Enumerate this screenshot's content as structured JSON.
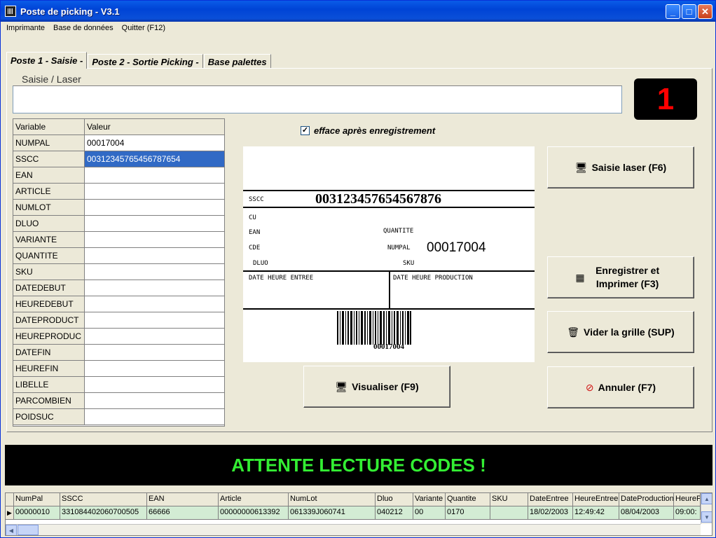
{
  "window": {
    "title": "Poste de picking - V3.1"
  },
  "menu": [
    {
      "label": "Imprimante"
    },
    {
      "label": "Base de données"
    },
    {
      "label": "Quitter (F12)"
    }
  ],
  "tabs": [
    {
      "label": "Poste 1 - Saisie -"
    },
    {
      "label": "Poste 2 - Sortie Picking -"
    },
    {
      "label": "Base palettes"
    }
  ],
  "saisie": {
    "label": "Saisie / Laser",
    "value": ""
  },
  "counter": "1",
  "grid": {
    "headers": [
      "Variable",
      "Valeur"
    ],
    "rows": [
      {
        "variable": "NUMPAL",
        "value": "00017004"
      },
      {
        "variable": "SSCC",
        "value": "00312345765456787654"
      },
      {
        "variable": "EAN",
        "value": ""
      },
      {
        "variable": "ARTICLE",
        "value": ""
      },
      {
        "variable": "NUMLOT",
        "value": ""
      },
      {
        "variable": "DLUO",
        "value": ""
      },
      {
        "variable": "VARIANTE",
        "value": ""
      },
      {
        "variable": "QUANTITE",
        "value": ""
      },
      {
        "variable": "SKU",
        "value": ""
      },
      {
        "variable": "DATEDEBUT",
        "value": ""
      },
      {
        "variable": "HEUREDEBUT",
        "value": ""
      },
      {
        "variable": "DATEPRODUCT",
        "value": ""
      },
      {
        "variable": "HEUREPRODUC",
        "value": ""
      },
      {
        "variable": "DATEFIN",
        "value": ""
      },
      {
        "variable": "HEUREFIN",
        "value": ""
      },
      {
        "variable": "LIBELLE",
        "value": ""
      },
      {
        "variable": "PARCOMBIEN",
        "value": ""
      },
      {
        "variable": "POIDSUC",
        "value": ""
      }
    ]
  },
  "checkbox": {
    "label": "efface après enregistrement",
    "checked": "✓"
  },
  "label_preview": {
    "sscc_label": "SSCC",
    "sscc_value": "003123457654567876",
    "cu_label": "CU",
    "ean_label": "EAN",
    "quantite_label": "QUANTITE",
    "cde_label": "CDE",
    "numpal_label": "NUMPAL",
    "numpal_value": "00017004",
    "dluo_label": "DLUO",
    "sku_label": "SKU",
    "date_entree_label": "DATE HEURE ENTREE",
    "date_production_label": "DATE HEURE PRODUCTION",
    "barcode_text": "00017004"
  },
  "buttons": {
    "saisie_laser": "Saisie laser (F6)",
    "enregistrer": "Enregistrer et Imprimer (F3)",
    "vider": "Vider la grille (SUP)",
    "visualiser": "Visualiser (F9)",
    "annuler": "Annuler (F7)"
  },
  "status": "ATTENTE LECTURE CODES !",
  "table": {
    "headers": [
      "NumPal",
      "SSCC",
      "EAN",
      "Article",
      "NumLot",
      "Dluo",
      "Variante",
      "Quantite",
      "SKU",
      "DateEntree",
      "HeureEntree",
      "DateProduction",
      "HeureP"
    ],
    "row": [
      "00000010",
      "331084402060700505",
      "66666",
      "00000000613392",
      "061339J060741",
      "040212",
      "00",
      "0170",
      "",
      "18/02/2003",
      "12:49:42",
      "08/04/2003",
      "09:00:"
    ]
  },
  "colors": {
    "title_bar": "#0a5ce8",
    "status_text": "#33ee33",
    "counter_text": "#ff0000",
    "selection": "#316ac5"
  }
}
